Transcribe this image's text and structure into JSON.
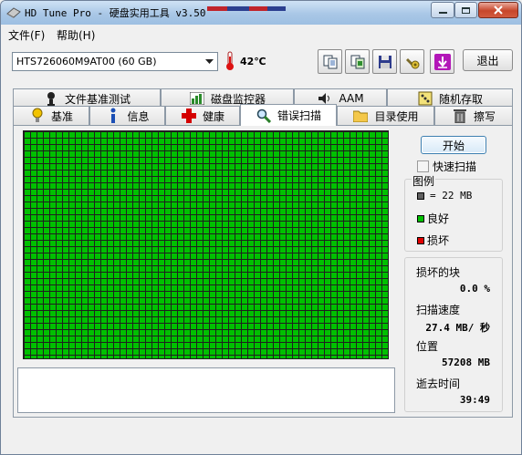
{
  "window": {
    "title": "HD Tune Pro - 硬盘实用工具 v3.50",
    "colors": {
      "titlebar": "#a9c7e6",
      "close": "#c7462b"
    }
  },
  "menu": [
    {
      "label": "文件(F)"
    },
    {
      "label": "帮助(H)"
    }
  ],
  "toolbar": {
    "drive": "HTS726060M9AT00 (60 GB)",
    "temperature": "42℃",
    "icons": [
      "copy-text-icon",
      "copy-screen-icon",
      "save-icon",
      "options-icon",
      "download-icon"
    ],
    "exit_label": "退出"
  },
  "tabs": {
    "row1": [
      {
        "label": "文件基准测试",
        "icon": "file-benchmark-icon"
      },
      {
        "label": "磁盘监控器",
        "icon": "disk-monitor-icon"
      },
      {
        "label": "AAM",
        "icon": "speaker-icon"
      },
      {
        "label": "随机存取",
        "icon": "random-access-icon"
      }
    ],
    "row2": [
      {
        "label": "基准",
        "icon": "benchmark-icon"
      },
      {
        "label": "信息",
        "icon": "info-icon"
      },
      {
        "label": "健康",
        "icon": "health-icon"
      },
      {
        "label": "错误扫描",
        "icon": "magnifier-icon",
        "active": true
      },
      {
        "label": "目录使用",
        "icon": "folder-icon"
      },
      {
        "label": "擦写",
        "icon": "trash-icon"
      }
    ]
  },
  "error_scan": {
    "start_label": "开始",
    "quick_scan_label": "快速扫描",
    "quick_scan_checked": false,
    "block_state": "all-good",
    "legend": {
      "title": "图例",
      "block_size": "= 22 MB",
      "good": "良好",
      "damaged": "损坏",
      "colors": {
        "block": "#606060",
        "good": "#00c000",
        "damaged": "#e00000"
      }
    },
    "stats": {
      "damaged_blocks_label": "损坏的块",
      "damaged_blocks_value": "0.0 %",
      "scan_speed_label": "扫描速度",
      "scan_speed_value": "27.4 MB/ 秒",
      "position_label": "位置",
      "position_value": "57208 MB",
      "elapsed_label": "逝去时间",
      "elapsed_value": "39:49"
    }
  }
}
